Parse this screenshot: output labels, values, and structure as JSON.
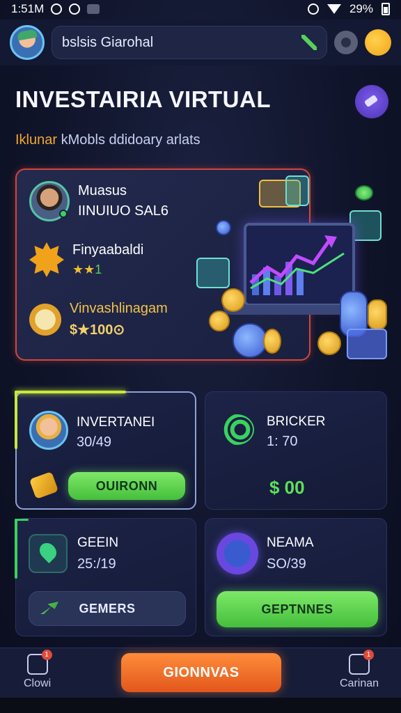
{
  "status_bar": {
    "time": "1:51M",
    "battery": "29%"
  },
  "top_bar": {
    "search_value": "bslsis Giarohal"
  },
  "header": {
    "title": "INVESTAIRIA VIRTUAL",
    "subtitle_accent": "Iklunar",
    "subtitle_rest": " kMobls ddidoary arlats"
  },
  "hero": {
    "user_line1": "Muasus",
    "user_line2": "IINUIUO SAL6",
    "badge_label": "Finyaabaldi",
    "badge_stars": "★★",
    "badge_num": "1",
    "gold_label": "Vinvashlinagam",
    "gold_value": "$★100⊙"
  },
  "cards": [
    {
      "title": "INVERTANEI",
      "value": "30/49",
      "button": "OUIRONN"
    },
    {
      "title": "BRICKER",
      "value": "1: 70",
      "money": "$ 00"
    },
    {
      "title": "GEEIN",
      "value": "25:/19",
      "button": "GEMERS"
    },
    {
      "title": "NEAMA",
      "value": "SO/39",
      "button": "GEPTNNES"
    }
  ],
  "bottom_nav": {
    "left_label": "Clowi",
    "left_badge": "1",
    "main_button": "GIONNVAS",
    "right_label": "Carinan",
    "right_badge": "1"
  },
  "colors": {
    "accent_orange": "#e2571c",
    "accent_green": "#56d05a",
    "hero_border": "#d2463c",
    "card_accent": "#c8e83c"
  }
}
